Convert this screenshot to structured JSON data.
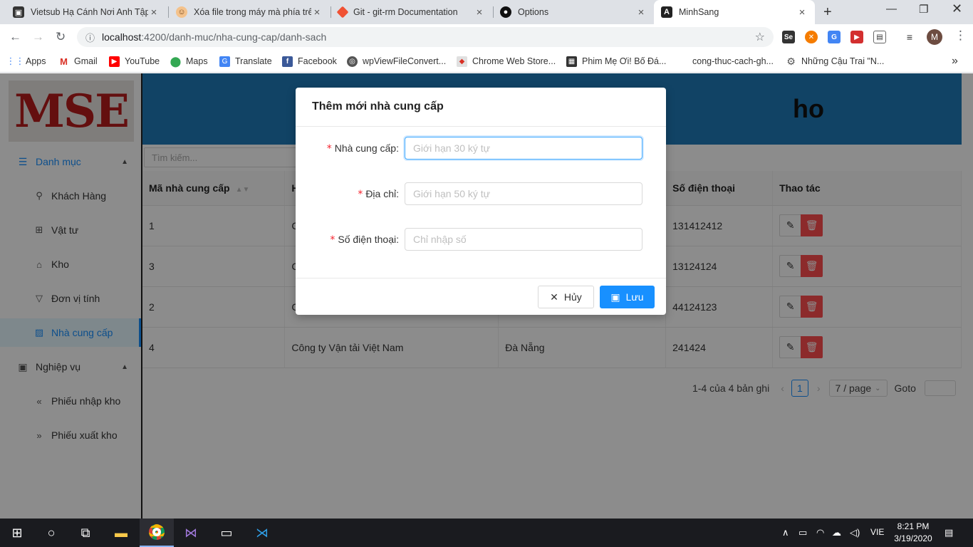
{
  "browser": {
    "tabs": [
      {
        "title": "Vietsub Hạ Cánh Nơi Anh Tập",
        "icon": "tv-icon"
      },
      {
        "title": "Xóa file trong máy mà phía trê",
        "icon": "face-icon"
      },
      {
        "title": "Git - git-rm Documentation",
        "icon": "git-icon"
      },
      {
        "title": "Options",
        "icon": "github-icon"
      },
      {
        "title": "MinhSang",
        "icon": "angular-icon"
      }
    ],
    "url_host": "localhost",
    "url_rest": ":4200/danh-muc/nha-cung-cap/danh-sach",
    "profile_initial": "M",
    "bookmarks": [
      "Apps",
      "Gmail",
      "YouTube",
      "Maps",
      "Translate",
      "Facebook",
      "wpViewFileConvert...",
      "Chrome Web Store...",
      "Phim Mẹ Ơi! Bố Đá...",
      "cong-thuc-cach-gh...",
      "Những Cậu Trai \"N..."
    ]
  },
  "sidebar": {
    "logo": "MSE",
    "groups": [
      {
        "label": "Danh mục",
        "icon": "list-icon",
        "items": [
          {
            "label": "Khách Hàng",
            "icon": "user-icon"
          },
          {
            "label": "Vật tư",
            "icon": "cluster-icon"
          },
          {
            "label": "Kho",
            "icon": "home-icon"
          },
          {
            "label": "Đơn vị tính",
            "icon": "filter-icon"
          },
          {
            "label": "Nhà cung cấp",
            "icon": "picture-icon"
          }
        ]
      },
      {
        "label": "Nghiệp vụ",
        "icon": "form-icon",
        "items": [
          {
            "label": "Phiếu nhập kho",
            "icon": "double-left-icon"
          },
          {
            "label": "Phiếu xuất kho",
            "icon": "double-right-icon"
          }
        ]
      }
    ]
  },
  "main": {
    "banner_title": "ho",
    "search_placeholder": "Tìm kiếm...",
    "table": {
      "columns": [
        "Mã nhà cung cấp",
        "H",
        "",
        "Số điện thoại",
        "Thao tác"
      ],
      "rows": [
        [
          "1",
          "C",
          "",
          "131412412"
        ],
        [
          "3",
          "C",
          "",
          "13124124"
        ],
        [
          "2",
          "C",
          "",
          "44124123"
        ],
        [
          "4",
          "Công ty Vận tải Việt Nam",
          "Đà Nẵng",
          "241424"
        ]
      ]
    },
    "pagination": {
      "total_text": "1-4 của 4 bản ghi",
      "current_page": "1",
      "page_size": "7 / page",
      "goto_label": "Goto"
    }
  },
  "modal": {
    "title": "Thêm mới nhà cung cấp",
    "fields": [
      {
        "label": "Nhà cung cấp:",
        "placeholder": "Giới hạn 30 ký tự",
        "value": ""
      },
      {
        "label": "Địa chỉ:",
        "placeholder": "Giới hạn 50 ký tự",
        "value": ""
      },
      {
        "label": "Số điện thoại:",
        "placeholder": "Chỉ nhập số",
        "value": ""
      }
    ],
    "cancel_label": "Hủy",
    "save_label": "Lưu"
  },
  "taskbar": {
    "language": "VIE",
    "time": "8:21 PM",
    "date": "3/19/2020"
  },
  "colors": {
    "primary": "#1890ff",
    "danger": "#ff4d4f",
    "banner": "#1f7bb8",
    "logo": "#b71c1c"
  }
}
